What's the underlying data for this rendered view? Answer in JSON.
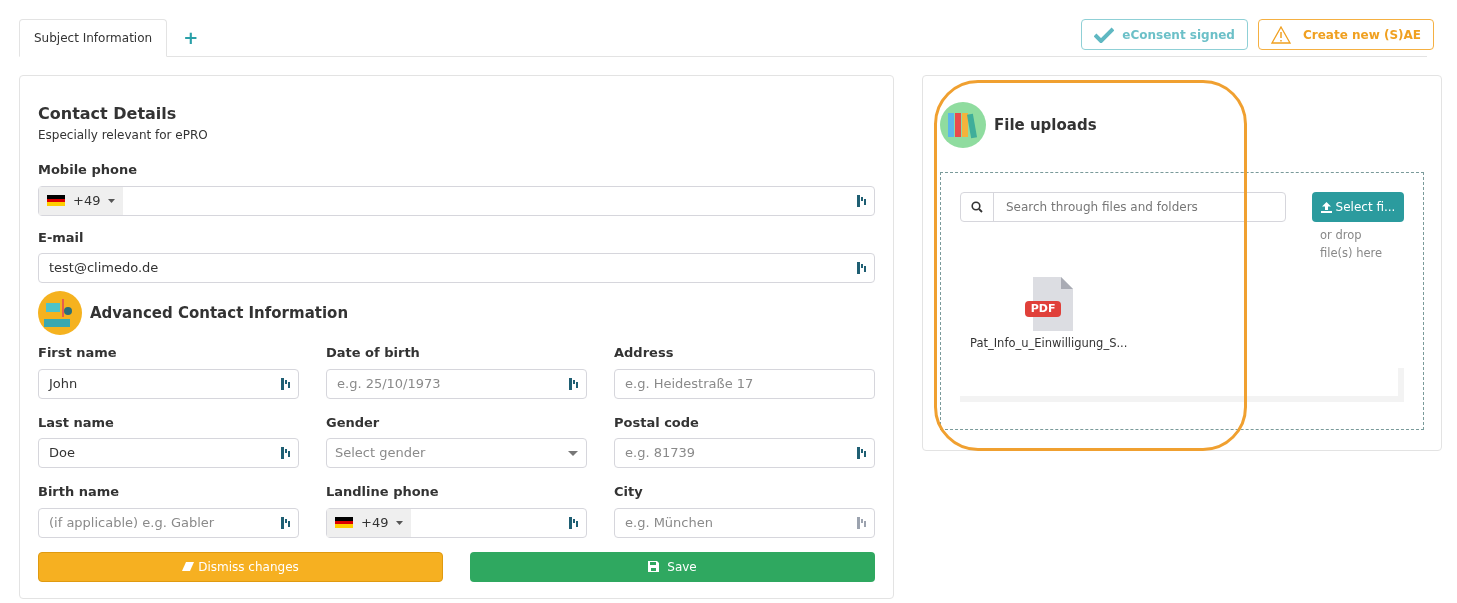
{
  "tabs": [
    {
      "label": "Subject Information",
      "selected": true
    }
  ],
  "add_tab": "+",
  "header_buttons": [
    {
      "label": "eConsent signed",
      "kind": "consent"
    },
    {
      "label": "Create new (S)AE",
      "kind": "warning"
    }
  ],
  "contact": {
    "title": "Contact Details",
    "subtitle": "Especially relevant for ePRO",
    "fields": [
      {
        "label": "Mobile phone",
        "kind": "phone",
        "code": "+49",
        "autofill": {
          "disabled": false
        }
      },
      {
        "label": "E-mail",
        "kind": "text",
        "value": "test@climedo.de",
        "autofill": {
          "disabled": false
        }
      }
    ]
  },
  "advanced": {
    "title": "Advanced Contact Information",
    "fields": [
      {
        "label": "First name",
        "kind": "text",
        "value": "John",
        "autofill": {
          "disabled": false
        }
      },
      {
        "label": "Date of birth",
        "kind": "text",
        "placeholder": "e.g. 25/10/1973",
        "autofill": {
          "disabled": false
        }
      },
      {
        "label": "Address",
        "kind": "text",
        "placeholder": "e.g. Heidestraße 17"
      },
      {
        "label": "Last name",
        "kind": "text",
        "value": "Doe",
        "autofill": {
          "disabled": false
        }
      },
      {
        "label": "Gender",
        "kind": "select",
        "placeholder": "Select gender"
      },
      {
        "label": "Postal code",
        "kind": "text",
        "placeholder": "e.g. 81739",
        "autofill": {
          "disabled": false
        }
      },
      {
        "label": "Birth name",
        "kind": "text",
        "placeholder": "(if applicable) e.g. Gabler",
        "autofill": {
          "disabled": false
        }
      },
      {
        "label": "Landline phone",
        "kind": "phone",
        "code": "+49",
        "autofill": {
          "disabled": false
        }
      },
      {
        "label": "City",
        "kind": "text",
        "placeholder": "e.g. München",
        "autofill": {
          "disabled": true
        }
      }
    ]
  },
  "actions": [
    {
      "label": "Dismiss changes",
      "kind": "dismiss"
    },
    {
      "label": "Save",
      "kind": "save"
    }
  ],
  "uploads": {
    "title": "File uploads",
    "search_placeholder": "Search through files and folders",
    "select_button": "Select fi...",
    "drop_hint": "or drop file(s) here",
    "files": [
      {
        "badge": "PDF",
        "name": "Pat_Info_u_Einwilligung_S..."
      }
    ]
  }
}
